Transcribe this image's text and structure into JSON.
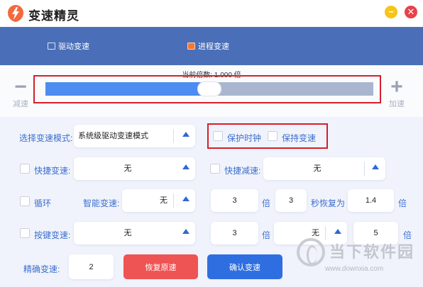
{
  "app": {
    "title": "变速精灵",
    "minimize_glyph": "−",
    "close_glyph": "✕",
    "accent": "#4a6fb8"
  },
  "tabs": [
    {
      "label": "驱动变速",
      "icon": "floppy-icon"
    },
    {
      "label": "进程变速",
      "icon": "window-icon"
    }
  ],
  "speed": {
    "caption": "当前倍数: 1.000 倍",
    "minus_sign": "−",
    "plus_sign": "+",
    "decrease_label": "减速",
    "increase_label": "加速",
    "slider_level": 0.5
  },
  "mode": {
    "label": "选择变速模式:",
    "value": "系统级驱动变速模式"
  },
  "protect_clock": {
    "label": "保护时钟",
    "checked": false
  },
  "keep_speed": {
    "label": "保持变速",
    "checked": false
  },
  "quick_speedup": {
    "label": "快捷变速:",
    "value": "无",
    "checked": false
  },
  "quick_slowdown": {
    "label": "快捷减速:",
    "value": "无",
    "checked": false
  },
  "loop": {
    "label": "循环",
    "checked": false,
    "smart_label": "智能变速:",
    "smart_value": "无",
    "multiple": "3",
    "multiple_unit": "倍",
    "seconds": "3",
    "restore_label": "秒恢复为",
    "restore_value": "1.4",
    "restore_unit": "倍"
  },
  "key_speed": {
    "label": "按键变速:",
    "value": "无",
    "checked": false,
    "multiple": "3",
    "multiple_unit": "倍",
    "key_value": "无",
    "amount": "5",
    "amount_unit": "倍"
  },
  "precise": {
    "label": "精确变速:",
    "value": "2"
  },
  "buttons": {
    "restore": "恢复原速",
    "confirm": "确认变速"
  },
  "watermark": {
    "text": "当下软件园",
    "url": "www.downxia.com"
  }
}
